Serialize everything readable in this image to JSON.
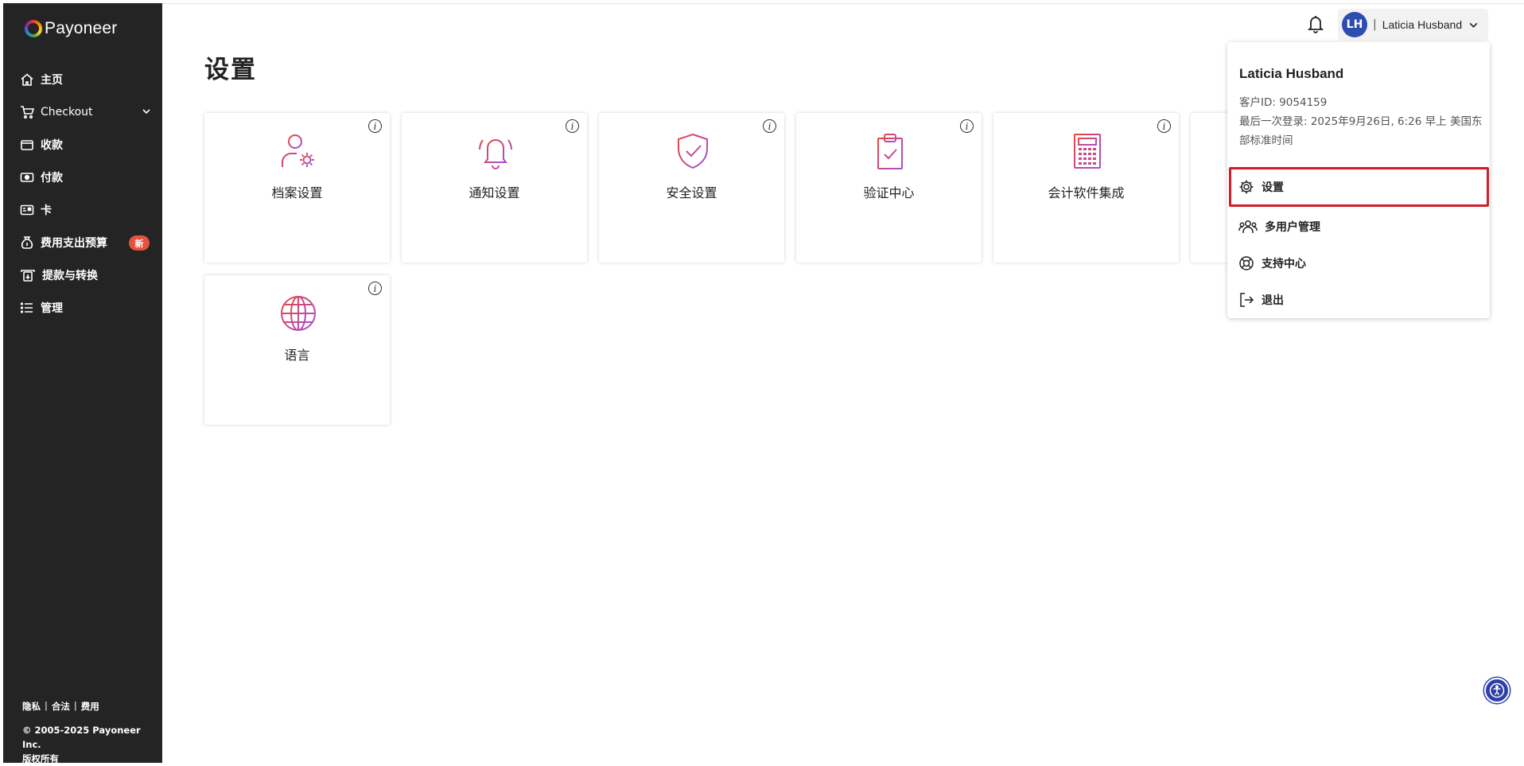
{
  "brand": {
    "name": "Payoneer"
  },
  "sidebar": {
    "items": [
      {
        "label": "主页",
        "icon": "home-icon"
      },
      {
        "label": "Checkout",
        "icon": "cart-icon"
      },
      {
        "label": "收款",
        "icon": "wallet-icon"
      },
      {
        "label": "付款",
        "icon": "money-icon"
      },
      {
        "label": "卡",
        "icon": "card-icon"
      },
      {
        "label": "费用支出预算",
        "icon": "moneybag-icon",
        "badge": "新"
      },
      {
        "label": "提款与转换",
        "icon": "withdraw-icon"
      },
      {
        "label": "管理",
        "icon": "list-icon"
      }
    ],
    "footer": {
      "links": [
        "隐私",
        "合法",
        "费用"
      ],
      "separator": "|",
      "copyright": "© 2005-2025 Payoneer Inc.",
      "rights": "版权所有"
    }
  },
  "main": {
    "title": "设置",
    "info_glyph": "i",
    "cards": [
      {
        "label": "档案设置",
        "icon": "profile-settings-icon"
      },
      {
        "label": "通知设置",
        "icon": "bell-notification-icon"
      },
      {
        "label": "安全设置",
        "icon": "shield-check-icon"
      },
      {
        "label": "验证中心",
        "icon": "clipboard-check-icon"
      },
      {
        "label": "会计软件集成",
        "icon": "calculator-icon"
      },
      {
        "label": "语言",
        "icon": "globe-icon"
      }
    ]
  },
  "header": {
    "avatar_initials": "LH",
    "separator": "|",
    "user_name": "Laticia Husband"
  },
  "user_menu": {
    "name": "Laticia Husband",
    "customer_id": "客户ID: 9054159",
    "last_login": "最后一次登录: 2025年9月26日, 6:26 早上 美国东部标准时间",
    "items": [
      {
        "label": "设置",
        "icon": "gear-icon",
        "highlighted": true
      },
      {
        "label": "多用户管理",
        "icon": "users-icon"
      },
      {
        "label": "支持中心",
        "icon": "lifebuoy-icon"
      },
      {
        "label": "退出",
        "icon": "logout-icon"
      }
    ]
  },
  "colors": {
    "sidebar_bg": "#242424",
    "highlight_border": "#d21e2b",
    "avatar_bg": "#2e4db0",
    "badge_bg": "#e5533d",
    "icon_gradient_start": "#e8473f",
    "icon_gradient_end": "#a64fd8"
  }
}
